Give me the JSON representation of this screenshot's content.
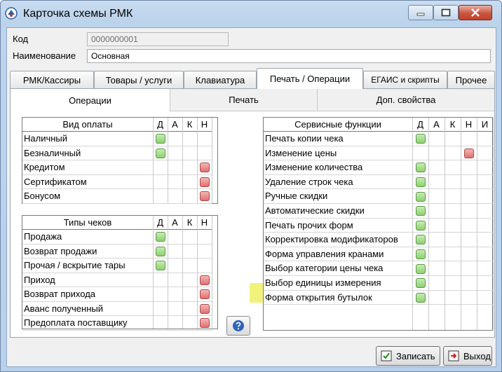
{
  "window": {
    "title": "Карточка схемы РМК"
  },
  "fields": {
    "code_label": "Код",
    "code_value": "0000000001",
    "name_label": "Наименование",
    "name_value": "Основная"
  },
  "tabs": [
    {
      "label": "РМК/Кассиры"
    },
    {
      "label": "Товары / услуги"
    },
    {
      "label": "Клавиатура"
    },
    {
      "label": "Печать / Операции"
    },
    {
      "label": "ЕГАИС и скрипты"
    },
    {
      "label": "Прочее"
    }
  ],
  "active_tab": "Печать / Операции",
  "subtabs": [
    {
      "label": "Операции"
    },
    {
      "label": "Печать"
    },
    {
      "label": "Доп. свойства"
    }
  ],
  "payment_grid": {
    "header": "Вид оплаты",
    "columns": [
      "Д",
      "А",
      "К",
      "Н"
    ],
    "rows": [
      {
        "name": "Наличный",
        "flags": [
          "green",
          "",
          "",
          ""
        ]
      },
      {
        "name": "Безналичный",
        "flags": [
          "green",
          "",
          "",
          ""
        ]
      },
      {
        "name": "Кредитом",
        "flags": [
          "",
          "",
          "",
          "red"
        ]
      },
      {
        "name": "Сертификатом",
        "flags": [
          "",
          "",
          "",
          "red"
        ]
      },
      {
        "name": "Бонусом",
        "flags": [
          "",
          "",
          "",
          "red"
        ]
      }
    ]
  },
  "receipt_grid": {
    "header": "Типы чеков",
    "columns": [
      "Д",
      "А",
      "К",
      "Н"
    ],
    "rows": [
      {
        "name": "Продажа",
        "flags": [
          "green",
          "",
          "",
          ""
        ]
      },
      {
        "name": "Возврат продажи",
        "flags": [
          "green",
          "",
          "",
          ""
        ]
      },
      {
        "name": "Прочая / вскрытие тары",
        "flags": [
          "green",
          "",
          "",
          ""
        ]
      },
      {
        "name": "Приход",
        "flags": [
          "",
          "",
          "",
          "red"
        ]
      },
      {
        "name": "Возврат прихода",
        "flags": [
          "",
          "",
          "",
          "red"
        ]
      },
      {
        "name": "Аванс полученный",
        "flags": [
          "",
          "",
          "",
          "red"
        ]
      },
      {
        "name": "Предоплата поставщику",
        "flags": [
          "",
          "",
          "",
          "red"
        ]
      }
    ]
  },
  "service_grid": {
    "header": "Сервисные функции",
    "columns": [
      "Д",
      "А",
      "К",
      "Н",
      "И"
    ],
    "rows": [
      {
        "name": "Печать копии чека",
        "flags": [
          "green",
          "",
          "",
          "",
          ""
        ]
      },
      {
        "name": "Изменение цены",
        "flags": [
          "",
          "",
          "",
          "red",
          ""
        ]
      },
      {
        "name": "Изменение количества",
        "flags": [
          "green",
          "",
          "",
          "",
          ""
        ]
      },
      {
        "name": "Удаление строк чека",
        "flags": [
          "green",
          "",
          "",
          "",
          ""
        ]
      },
      {
        "name": "Ручные скидки",
        "flags": [
          "green",
          "",
          "",
          "",
          ""
        ]
      },
      {
        "name": "Автоматические скидки",
        "flags": [
          "green",
          "",
          "",
          "",
          ""
        ]
      },
      {
        "name": "Печать прочих форм",
        "flags": [
          "green",
          "",
          "",
          "",
          ""
        ]
      },
      {
        "name": "Корректировка модификаторов",
        "flags": [
          "green",
          "",
          "",
          "",
          ""
        ]
      },
      {
        "name": "Форма управления кранами",
        "flags": [
          "green",
          "",
          "",
          "",
          ""
        ]
      },
      {
        "name": "Выбор категории цены чека",
        "flags": [
          "green",
          "",
          "",
          "",
          ""
        ]
      },
      {
        "name": "Выбор единицы измерения",
        "flags": [
          "green",
          "",
          "",
          "",
          ""
        ]
      },
      {
        "name": "Форма открытия бутылок",
        "flags": [
          "green",
          "",
          "",
          "",
          ""
        ],
        "highlighted": true
      }
    ]
  },
  "buttons": {
    "save": "Записать",
    "exit": "Выход"
  },
  "icons": {
    "app": "app-logo-icon",
    "help": "help-icon",
    "save": "save-icon",
    "exit": "exit-icon"
  },
  "colors": {
    "flag_green": "#8ed071",
    "flag_red": "#e26f6f",
    "highlight": "#f2f27a",
    "title_bg": "#bcd3ec"
  }
}
